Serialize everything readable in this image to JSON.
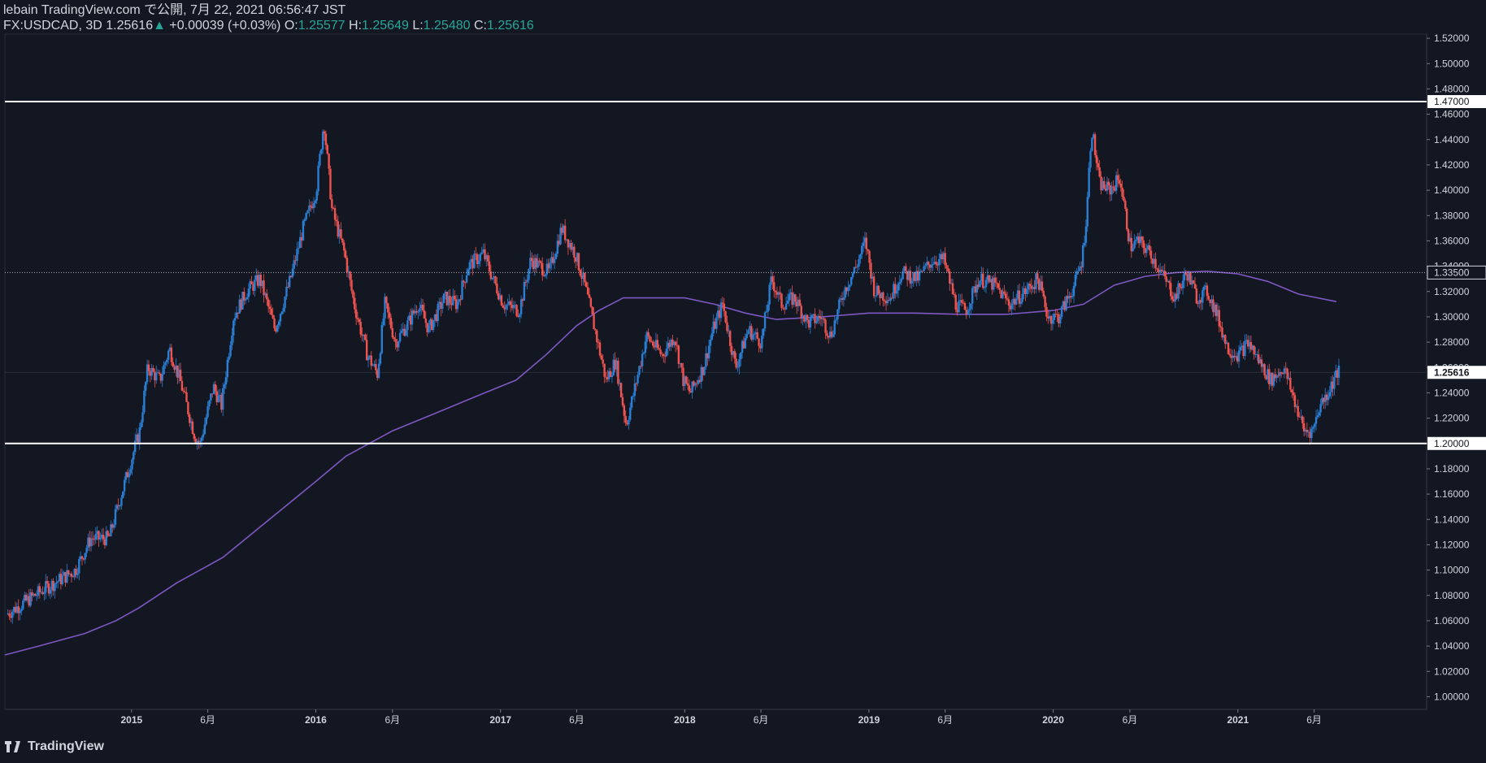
{
  "header": {
    "publish_line": "lebain TradingView.com で公開, 7月 22, 2021 06:56:47 JST",
    "symbol": "FX:USDCAD, 3D",
    "last": "1.25616",
    "change_arrow": "▲",
    "change": "+0.00039 (+0.03%)",
    "o_label": "O:",
    "o_value": "1.25577",
    "h_label": "H:",
    "h_value": "1.25649",
    "l_label": "L:",
    "l_value": "1.25480",
    "c_label": "C:",
    "c_value": "1.25616"
  },
  "footer": {
    "brand": "TradingView"
  },
  "colors": {
    "background": "#131722",
    "up": "#2a7fd4",
    "down": "#ef5350",
    "ma": "#7e57c2",
    "hline": "#ffffff",
    "dotted": "#b2b5be",
    "text": "#d1d4dc",
    "change_up": "#26a69a"
  },
  "chart_data": {
    "type": "candlestick",
    "symbol": "FX:USDCAD",
    "interval": "3D",
    "ylim": [
      0.99,
      1.522
    ],
    "y_ticks": [
      1.0,
      1.02,
      1.04,
      1.06,
      1.08,
      1.1,
      1.12,
      1.14,
      1.16,
      1.18,
      1.2,
      1.22,
      1.24,
      1.26,
      1.28,
      1.3,
      1.32,
      1.34,
      1.36,
      1.38,
      1.4,
      1.42,
      1.44,
      1.46,
      1.48,
      1.5,
      1.52
    ],
    "x_ticks": [
      {
        "label": "2015",
        "date": "2015-01-01"
      },
      {
        "label": "6月",
        "date": "2015-06-01"
      },
      {
        "label": "2016",
        "date": "2016-01-01"
      },
      {
        "label": "6月",
        "date": "2016-06-01"
      },
      {
        "label": "2017",
        "date": "2017-01-01"
      },
      {
        "label": "6月",
        "date": "2017-06-01"
      },
      {
        "label": "2018",
        "date": "2018-01-01"
      },
      {
        "label": "6月",
        "date": "2018-06-01"
      },
      {
        "label": "2019",
        "date": "2019-01-01"
      },
      {
        "label": "6月",
        "date": "2019-06-01"
      },
      {
        "label": "2020",
        "date": "2020-01-01"
      },
      {
        "label": "6月",
        "date": "2020-06-01"
      },
      {
        "label": "2021",
        "date": "2021-01-01"
      },
      {
        "label": "6月",
        "date": "2021-06-01"
      }
    ],
    "price_path": [
      [
        "2014-05-01",
        1.065
      ],
      [
        "2014-07-15",
        1.085
      ],
      [
        "2014-09-15",
        1.1
      ],
      [
        "2014-10-15",
        1.125
      ],
      [
        "2014-11-20",
        1.125
      ],
      [
        "2014-12-15",
        1.16
      ],
      [
        "2015-01-20",
        1.21
      ],
      [
        "2015-02-05",
        1.26
      ],
      [
        "2015-03-01",
        1.25
      ],
      [
        "2015-03-20",
        1.275
      ],
      [
        "2015-04-10",
        1.25
      ],
      [
        "2015-05-10",
        1.205
      ],
      [
        "2015-05-20",
        1.2
      ],
      [
        "2015-06-15",
        1.245
      ],
      [
        "2015-07-01",
        1.23
      ],
      [
        "2015-07-25",
        1.3
      ],
      [
        "2015-08-20",
        1.32
      ],
      [
        "2015-09-15",
        1.33
      ],
      [
        "2015-10-15",
        1.29
      ],
      [
        "2015-11-15",
        1.33
      ],
      [
        "2015-12-10",
        1.37
      ],
      [
        "2016-01-05",
        1.4
      ],
      [
        "2016-01-20",
        1.455
      ],
      [
        "2016-02-05",
        1.385
      ],
      [
        "2016-03-01",
        1.35
      ],
      [
        "2016-03-20",
        1.31
      ],
      [
        "2016-04-15",
        1.27
      ],
      [
        "2016-05-05",
        1.255
      ],
      [
        "2016-05-20",
        1.31
      ],
      [
        "2016-06-10",
        1.28
      ],
      [
        "2016-07-05",
        1.295
      ],
      [
        "2016-07-25",
        1.31
      ],
      [
        "2016-08-15",
        1.29
      ],
      [
        "2016-09-15",
        1.315
      ],
      [
        "2016-10-10",
        1.31
      ],
      [
        "2016-11-01",
        1.34
      ],
      [
        "2016-12-01",
        1.35
      ],
      [
        "2016-12-20",
        1.33
      ],
      [
        "2017-01-10",
        1.31
      ],
      [
        "2017-02-10",
        1.305
      ],
      [
        "2017-03-05",
        1.345
      ],
      [
        "2017-04-10",
        1.335
      ],
      [
        "2017-05-05",
        1.37
      ],
      [
        "2017-06-01",
        1.35
      ],
      [
        "2017-06-20",
        1.325
      ],
      [
        "2017-07-10",
        1.29
      ],
      [
        "2017-08-01",
        1.25
      ],
      [
        "2017-08-20",
        1.265
      ],
      [
        "2017-09-10",
        1.215
      ],
      [
        "2017-09-25",
        1.24
      ],
      [
        "2017-10-20",
        1.285
      ],
      [
        "2017-11-20",
        1.27
      ],
      [
        "2017-12-15",
        1.285
      ],
      [
        "2018-01-01",
        1.25
      ],
      [
        "2018-01-15",
        1.24
      ],
      [
        "2018-02-10",
        1.26
      ],
      [
        "2018-03-01",
        1.29
      ],
      [
        "2018-03-20",
        1.31
      ],
      [
        "2018-04-15",
        1.26
      ],
      [
        "2018-05-10",
        1.29
      ],
      [
        "2018-06-05",
        1.28
      ],
      [
        "2018-06-25",
        1.33
      ],
      [
        "2018-07-15",
        1.31
      ],
      [
        "2018-08-10",
        1.315
      ],
      [
        "2018-09-05",
        1.295
      ],
      [
        "2018-10-01",
        1.3
      ],
      [
        "2018-10-20",
        1.285
      ],
      [
        "2018-11-15",
        1.32
      ],
      [
        "2018-12-10",
        1.34
      ],
      [
        "2018-12-28",
        1.36
      ],
      [
        "2019-01-15",
        1.32
      ],
      [
        "2019-02-15",
        1.315
      ],
      [
        "2019-03-10",
        1.335
      ],
      [
        "2019-04-10",
        1.33
      ],
      [
        "2019-05-10",
        1.345
      ],
      [
        "2019-06-01",
        1.345
      ],
      [
        "2019-06-25",
        1.31
      ],
      [
        "2019-07-15",
        1.305
      ],
      [
        "2019-08-10",
        1.33
      ],
      [
        "2019-09-10",
        1.325
      ],
      [
        "2019-10-10",
        1.31
      ],
      [
        "2019-11-10",
        1.32
      ],
      [
        "2019-12-05",
        1.33
      ],
      [
        "2019-12-25",
        1.3
      ],
      [
        "2020-01-15",
        1.3
      ],
      [
        "2020-02-15",
        1.325
      ],
      [
        "2020-03-01",
        1.345
      ],
      [
        "2020-03-10",
        1.38
      ],
      [
        "2020-03-20",
        1.45
      ],
      [
        "2020-04-05",
        1.405
      ],
      [
        "2020-04-25",
        1.4
      ],
      [
        "2020-05-15",
        1.41
      ],
      [
        "2020-06-05",
        1.355
      ],
      [
        "2020-06-20",
        1.36
      ],
      [
        "2020-07-15",
        1.35
      ],
      [
        "2020-08-05",
        1.335
      ],
      [
        "2020-09-01",
        1.315
      ],
      [
        "2020-09-25",
        1.335
      ],
      [
        "2020-10-15",
        1.315
      ],
      [
        "2020-11-05",
        1.32
      ],
      [
        "2020-11-25",
        1.3
      ],
      [
        "2020-12-15",
        1.275
      ],
      [
        "2021-01-05",
        1.27
      ],
      [
        "2021-01-25",
        1.28
      ],
      [
        "2021-02-15",
        1.265
      ],
      [
        "2021-03-10",
        1.25
      ],
      [
        "2021-04-05",
        1.26
      ],
      [
        "2021-04-25",
        1.235
      ],
      [
        "2021-05-15",
        1.21
      ],
      [
        "2021-06-01",
        1.21
      ],
      [
        "2021-06-15",
        1.23
      ],
      [
        "2021-07-01",
        1.24
      ],
      [
        "2021-07-20",
        1.256
      ]
    ],
    "moving_average": [
      [
        "2014-04-25",
        1.033
      ],
      [
        "2014-07-01",
        1.04
      ],
      [
        "2014-10-01",
        1.05
      ],
      [
        "2014-12-01",
        1.06
      ],
      [
        "2015-01-15",
        1.07
      ],
      [
        "2015-04-01",
        1.09
      ],
      [
        "2015-07-01",
        1.11
      ],
      [
        "2015-10-01",
        1.14
      ],
      [
        "2016-01-01",
        1.17
      ],
      [
        "2016-03-01",
        1.19
      ],
      [
        "2016-06-01",
        1.21
      ],
      [
        "2016-09-01",
        1.225
      ],
      [
        "2016-12-01",
        1.24
      ],
      [
        "2017-02-01",
        1.25
      ],
      [
        "2017-04-01",
        1.27
      ],
      [
        "2017-06-01",
        1.293
      ],
      [
        "2017-07-15",
        1.305
      ],
      [
        "2017-09-01",
        1.315
      ],
      [
        "2017-11-01",
        1.315
      ],
      [
        "2018-01-01",
        1.315
      ],
      [
        "2018-03-01",
        1.31
      ],
      [
        "2018-05-01",
        1.303
      ],
      [
        "2018-07-01",
        1.298
      ],
      [
        "2018-10-01",
        1.3
      ],
      [
        "2019-01-01",
        1.303
      ],
      [
        "2019-04-01",
        1.303
      ],
      [
        "2019-07-01",
        1.302
      ],
      [
        "2019-10-01",
        1.302
      ],
      [
        "2020-01-01",
        1.305
      ],
      [
        "2020-03-01",
        1.31
      ],
      [
        "2020-05-01",
        1.325
      ],
      [
        "2020-07-01",
        1.332
      ],
      [
        "2020-09-01",
        1.335
      ],
      [
        "2020-11-01",
        1.336
      ],
      [
        "2021-01-01",
        1.334
      ],
      [
        "2021-03-01",
        1.328
      ],
      [
        "2021-05-01",
        1.318
      ],
      [
        "2021-07-15",
        1.312
      ]
    ],
    "horizontal_lines": [
      {
        "price": 1.47,
        "label": "1.47000",
        "style": "solid"
      },
      {
        "price": 1.335,
        "label": "1.33500",
        "style": "dotted"
      },
      {
        "price": 1.2,
        "label": "1.20000",
        "style": "solid"
      }
    ],
    "last_price": {
      "price": 1.25616,
      "label": "1.25616"
    },
    "date_range": [
      "2014-04-25",
      "2022-01-10"
    ]
  }
}
